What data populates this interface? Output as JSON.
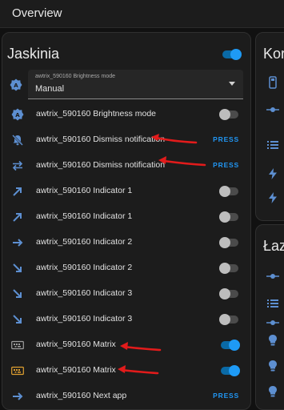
{
  "header": {
    "title": "Overview"
  },
  "card": {
    "title": "Jaskinia",
    "select": {
      "label": "awtrix_590160 Brightness mode",
      "value": "Manual"
    },
    "rows": [
      {
        "name": "awtrix_590160 Brightness mode",
        "control": "toggle",
        "state": "off",
        "icon": "brightness-auto-icon"
      },
      {
        "name": "awtrix_590160 Dismiss notification",
        "control": "press",
        "press_label": "PRESS",
        "icon": "bell-off-icon"
      },
      {
        "name": "awtrix_590160 Dismiss notification",
        "control": "press",
        "press_label": "PRESS",
        "icon": "swap-arrows-icon"
      },
      {
        "name": "awtrix_590160 Indicator 1",
        "control": "toggle",
        "state": "off",
        "icon": "arrow-up-right-icon"
      },
      {
        "name": "awtrix_590160 Indicator 1",
        "control": "toggle",
        "state": "off",
        "icon": "arrow-up-right-icon"
      },
      {
        "name": "awtrix_590160 Indicator 2",
        "control": "toggle",
        "state": "off",
        "icon": "arrow-right-icon"
      },
      {
        "name": "awtrix_590160 Indicator 2",
        "control": "toggle",
        "state": "off",
        "icon": "arrow-down-right-icon"
      },
      {
        "name": "awtrix_590160 Indicator 3",
        "control": "toggle",
        "state": "off",
        "icon": "arrow-down-right-icon"
      },
      {
        "name": "awtrix_590160 Indicator 3",
        "control": "toggle",
        "state": "off",
        "icon": "arrow-down-right-icon"
      },
      {
        "name": "awtrix_590160 Matrix",
        "control": "toggle",
        "state": "on",
        "icon": "led-matrix-icon"
      },
      {
        "name": "awtrix_590160 Matrix",
        "control": "toggle",
        "state": "on",
        "icon": "led-matrix-icon"
      },
      {
        "name": "awtrix_590160 Next app",
        "control": "press",
        "press_label": "PRESS",
        "icon": "arrow-right-icon"
      }
    ]
  },
  "side_cards": [
    {
      "title": "Kor"
    },
    {
      "title": "Łaz"
    }
  ],
  "colors": {
    "accent": "#2196f3",
    "icon_blue": "#5d8fd1",
    "annotation_red": "#e21b1b",
    "matrix_on": "#e0a030"
  }
}
